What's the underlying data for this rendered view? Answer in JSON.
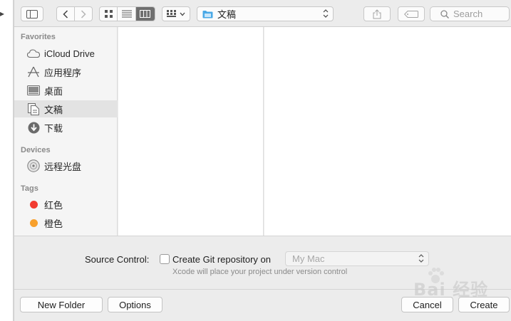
{
  "toolbar": {
    "path_label": "文稿",
    "search_placeholder": "Search"
  },
  "sidebar": {
    "favorites_title": "Favorites",
    "favorites": [
      {
        "label": "iCloud Drive",
        "icon": "cloud-icon"
      },
      {
        "label": "应用程序",
        "icon": "applications-icon"
      },
      {
        "label": "桌面",
        "icon": "desktop-icon"
      },
      {
        "label": "文稿",
        "icon": "documents-icon",
        "selected": true
      },
      {
        "label": "下载",
        "icon": "downloads-icon"
      }
    ],
    "devices_title": "Devices",
    "devices": [
      {
        "label": "远程光盘",
        "icon": "disc-icon"
      }
    ],
    "tags_title": "Tags",
    "tags": [
      {
        "label": "红色",
        "color": "#f23b30"
      },
      {
        "label": "橙色",
        "color": "#f8a02c"
      }
    ]
  },
  "options": {
    "source_control_label": "Source Control:",
    "git_checkbox_label": "Create Git repository on",
    "git_checked": false,
    "location_value": "My Mac",
    "note": "Xcode will place your project under version control"
  },
  "buttons": {
    "new_folder": "New Folder",
    "options": "Options",
    "cancel": "Cancel",
    "create": "Create"
  },
  "watermark": {
    "text": "Bai 经验"
  },
  "colors": {
    "selected_bg": "#e3e3e3",
    "folder_blue": "#49a8e6"
  }
}
